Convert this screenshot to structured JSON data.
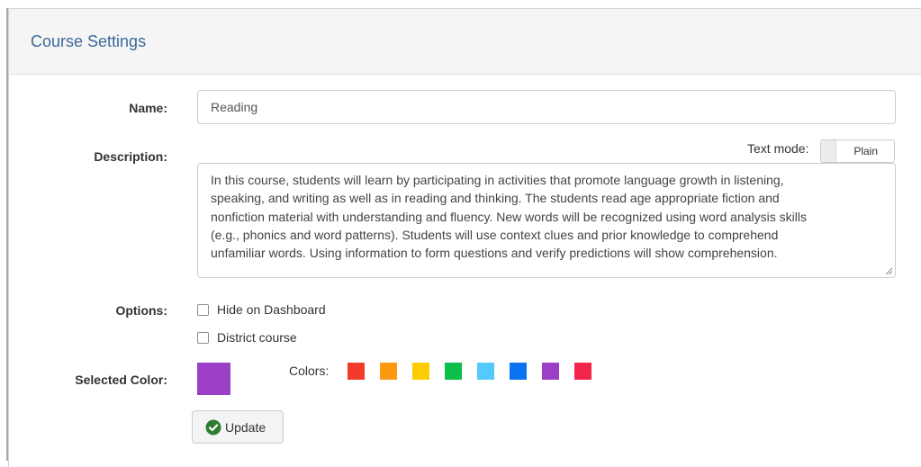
{
  "panel": {
    "title": "Course Settings"
  },
  "form": {
    "name_label": "Name:",
    "name_value": "Reading",
    "description_label": "Description:",
    "text_mode_label": "Text mode:",
    "text_mode_value": "Plain",
    "description_lines": [
      "In this course, students will learn by participating in activities that promote language growth in listening,",
      "speaking, and writing as well as in reading and thinking. The students read age appropriate fiction and",
      "nonfiction material with understanding and fluency. New words will be recognized using word analysis skills",
      "(e.g., phonics and word patterns). Students will use context clues and prior knowledge to comprehend",
      "unfamiliar words. Using information to form questions and verify predictions will show comprehension."
    ],
    "options_label": "Options:",
    "options": [
      {
        "label": "Hide on Dashboard",
        "checked": false
      },
      {
        "label": "District course",
        "checked": false
      }
    ],
    "selected_color_label": "Selected Color:",
    "selected_color": "#9b3fc7",
    "colors_label": "Colors:",
    "colors": [
      "#f23b2a",
      "#fb9a11",
      "#fccb00",
      "#0cbe4a",
      "#54c9fb",
      "#0a73f0",
      "#9b3fc7",
      "#f2254b"
    ],
    "update_label": "Update",
    "update_icon": "check-circle-icon",
    "update_icon_color": "#2e7d32"
  }
}
